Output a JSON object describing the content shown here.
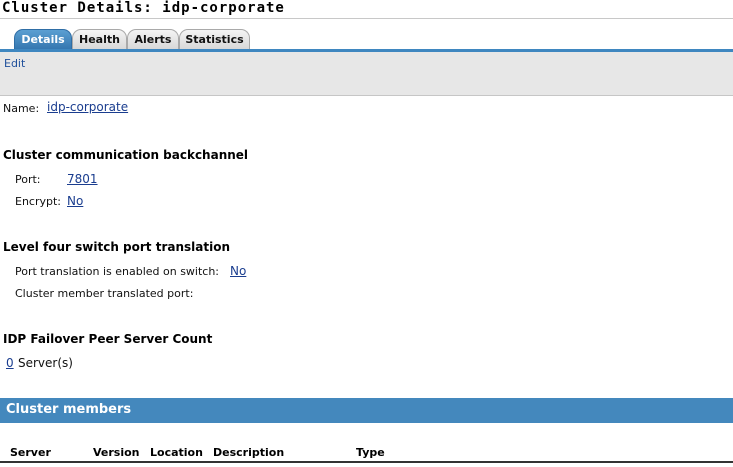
{
  "page": {
    "title": "Cluster Details: idp-corporate"
  },
  "tabs": [
    {
      "label": "Details",
      "active": true
    },
    {
      "label": "Health",
      "active": false
    },
    {
      "label": "Alerts",
      "active": false
    },
    {
      "label": "Statistics",
      "active": false
    }
  ],
  "toolbar": {
    "edit_label": "Edit"
  },
  "name": {
    "label": "Name:",
    "value": "idp-corporate"
  },
  "backchannel": {
    "heading": "Cluster communication backchannel",
    "port_label": "Port:",
    "port_value": "7801",
    "encrypt_label": "Encrypt:",
    "encrypt_value": "No"
  },
  "l4": {
    "heading": "Level four switch port translation",
    "enabled_label": "Port translation is enabled on switch:",
    "enabled_value": "No",
    "member_port_label": "Cluster member translated port:"
  },
  "failover": {
    "heading": "IDP Failover Peer Server Count",
    "count": "0",
    "suffix": "Server(s)"
  },
  "members": {
    "title": "Cluster members",
    "columns": [
      "Server",
      "Version",
      "Location",
      "Description",
      "Type"
    ]
  },
  "colors": {
    "accent": "#4488bd",
    "active_tab": "#3f87c0",
    "link": "#1a3d8f",
    "toolbar_bg": "#e7e7e7"
  }
}
